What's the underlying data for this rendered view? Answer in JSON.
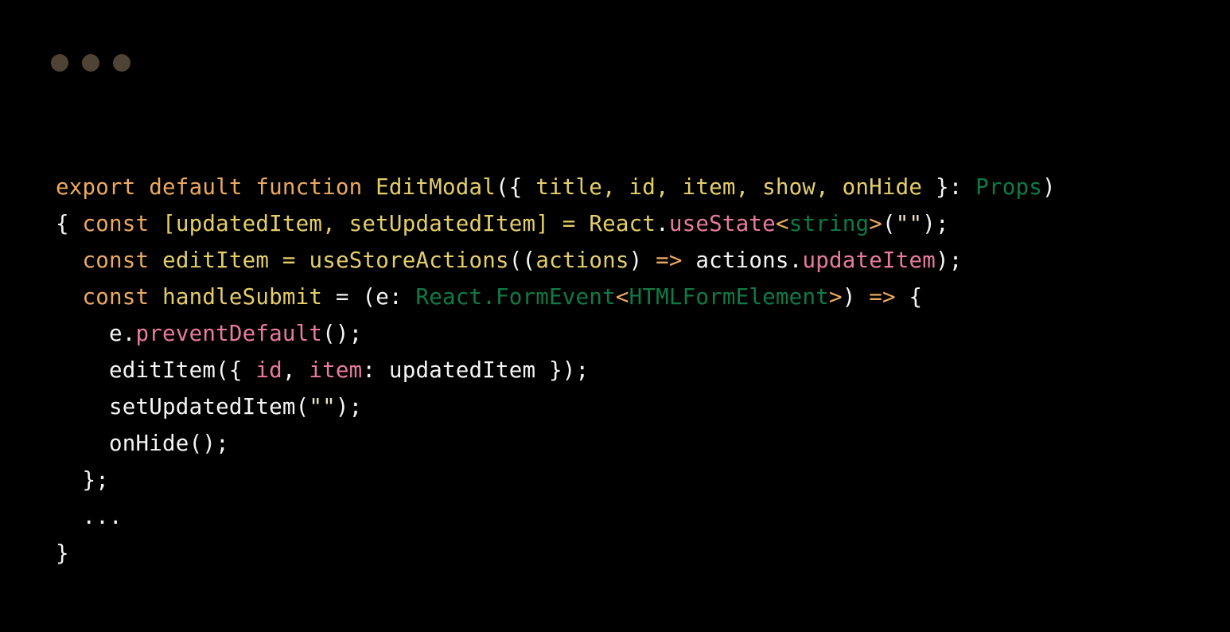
{
  "window": {
    "background_color": "#000000",
    "traffic_lights": [
      {
        "name": "close-dot",
        "color": "#4e4334"
      },
      {
        "name": "minimize-dot",
        "color": "#4e4334"
      },
      {
        "name": "maximize-dot",
        "color": "#4e4334"
      }
    ]
  },
  "palette": {
    "plain": "#f5f5f5",
    "keyword": "#eba961",
    "operator": "#eba961",
    "function": "#e3ce6a",
    "param": "#e3ce6a",
    "variable": "#e3ce6a",
    "type": "#0e7a46",
    "method": "#e87ba0",
    "property": "#e87ba0",
    "string": "#ece6c4"
  },
  "code": {
    "language": "tsx",
    "plain_text": "export default function EditModal({ title, id, item, show, onHide }: Props) { const [updatedItem, setUpdatedItem] = React.useState<string>(\"\");\n  const editItem = useStoreActions((actions) => actions.updateItem);\n  const handleSubmit = (e: React.FormEvent<HTMLFormElement>) => {\n    e.preventDefault();\n    editItem({ id, item: updatedItem });\n    setUpdatedItem(\"\");\n    onHide();\n  };\n  ...\n}",
    "lines": [
      {
        "tokens": [
          {
            "text": "export default function ",
            "kind": "keyword"
          },
          {
            "text": "EditModal",
            "kind": "function"
          },
          {
            "text": "(",
            "kind": "plain"
          },
          {
            "text": "{ ",
            "kind": "plain"
          },
          {
            "text": "title, id, item, show, onHide",
            "kind": "param"
          },
          {
            "text": " }: ",
            "kind": "plain"
          },
          {
            "text": "Props",
            "kind": "type"
          },
          {
            "text": ")",
            "kind": "plain"
          }
        ]
      },
      {
        "tokens": [
          {
            "text": "{ ",
            "kind": "plain"
          },
          {
            "text": "const",
            "kind": "keyword"
          },
          {
            "text": " ",
            "kind": "plain"
          },
          {
            "text": "[updatedItem, setUpdatedItem]",
            "kind": "variable"
          },
          {
            "text": " ",
            "kind": "plain"
          },
          {
            "text": "=",
            "kind": "variable"
          },
          {
            "text": " ",
            "kind": "plain"
          },
          {
            "text": "React",
            "kind": "variable"
          },
          {
            "text": ".",
            "kind": "plain"
          },
          {
            "text": "useState",
            "kind": "method"
          },
          {
            "text": "<",
            "kind": "operator"
          },
          {
            "text": "string",
            "kind": "type"
          },
          {
            "text": ">",
            "kind": "operator"
          },
          {
            "text": "(",
            "kind": "plain"
          },
          {
            "text": "\"\"",
            "kind": "string"
          },
          {
            "text": ");",
            "kind": "plain"
          }
        ]
      },
      {
        "tokens": [
          {
            "text": "  ",
            "kind": "plain"
          },
          {
            "text": "const",
            "kind": "keyword"
          },
          {
            "text": " ",
            "kind": "plain"
          },
          {
            "text": "editItem",
            "kind": "variable"
          },
          {
            "text": " ",
            "kind": "plain"
          },
          {
            "text": "=",
            "kind": "variable"
          },
          {
            "text": " ",
            "kind": "plain"
          },
          {
            "text": "useStoreActions",
            "kind": "variable"
          },
          {
            "text": "((",
            "kind": "plain"
          },
          {
            "text": "actions",
            "kind": "param"
          },
          {
            "text": ") ",
            "kind": "plain"
          },
          {
            "text": "=>",
            "kind": "operator"
          },
          {
            "text": " actions.",
            "kind": "plain"
          },
          {
            "text": "updateItem",
            "kind": "property"
          },
          {
            "text": ");",
            "kind": "plain"
          }
        ]
      },
      {
        "tokens": [
          {
            "text": "  ",
            "kind": "plain"
          },
          {
            "text": "const",
            "kind": "keyword"
          },
          {
            "text": " ",
            "kind": "plain"
          },
          {
            "text": "handleSubmit",
            "kind": "variable"
          },
          {
            "text": " ",
            "kind": "plain"
          },
          {
            "text": "=",
            "kind": "plain"
          },
          {
            "text": " (e: ",
            "kind": "plain"
          },
          {
            "text": "React.FormEvent",
            "kind": "type"
          },
          {
            "text": "<",
            "kind": "operator"
          },
          {
            "text": "HTMLFormElement",
            "kind": "type"
          },
          {
            "text": ">",
            "kind": "operator"
          },
          {
            "text": ") ",
            "kind": "plain"
          },
          {
            "text": "=>",
            "kind": "operator"
          },
          {
            "text": " {",
            "kind": "plain"
          }
        ]
      },
      {
        "tokens": [
          {
            "text": "    e.",
            "kind": "plain"
          },
          {
            "text": "preventDefault",
            "kind": "method"
          },
          {
            "text": "();",
            "kind": "plain"
          }
        ]
      },
      {
        "tokens": [
          {
            "text": "    editItem({ ",
            "kind": "plain"
          },
          {
            "text": "id",
            "kind": "property"
          },
          {
            "text": ", ",
            "kind": "plain"
          },
          {
            "text": "item",
            "kind": "property"
          },
          {
            "text": ": updatedItem });",
            "kind": "plain"
          }
        ]
      },
      {
        "tokens": [
          {
            "text": "    setUpdatedItem(",
            "kind": "plain"
          },
          {
            "text": "\"\"",
            "kind": "string"
          },
          {
            "text": ");",
            "kind": "plain"
          }
        ]
      },
      {
        "tokens": [
          {
            "text": "    onHide();",
            "kind": "plain"
          }
        ]
      },
      {
        "tokens": [
          {
            "text": "  };",
            "kind": "plain"
          }
        ]
      },
      {
        "tokens": [
          {
            "text": "  ...",
            "kind": "plain"
          }
        ]
      },
      {
        "tokens": [
          {
            "text": "}",
            "kind": "plain"
          }
        ]
      }
    ]
  }
}
